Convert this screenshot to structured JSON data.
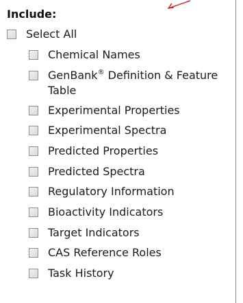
{
  "header": {
    "title": "Include:"
  },
  "select_all": {
    "label": "Select All"
  },
  "options": [
    {
      "label": "Chemical Names"
    },
    {
      "label_pre": "GenBank",
      "label_sup": "®",
      "label_post": " Definition & Feature",
      "label_line2": "Table"
    },
    {
      "label": "Experimental Properties"
    },
    {
      "label": "Experimental Spectra"
    },
    {
      "label": "Predicted Properties"
    },
    {
      "label": "Predicted Spectra"
    },
    {
      "label": "Regulatory Information"
    },
    {
      "label": "Bioactivity Indicators"
    },
    {
      "label": "Target Indicators"
    },
    {
      "label": "CAS Reference Roles"
    },
    {
      "label": "Task History"
    }
  ],
  "colors": {
    "arrow": "#d9262c",
    "frame_border": "#8a8a8a"
  }
}
